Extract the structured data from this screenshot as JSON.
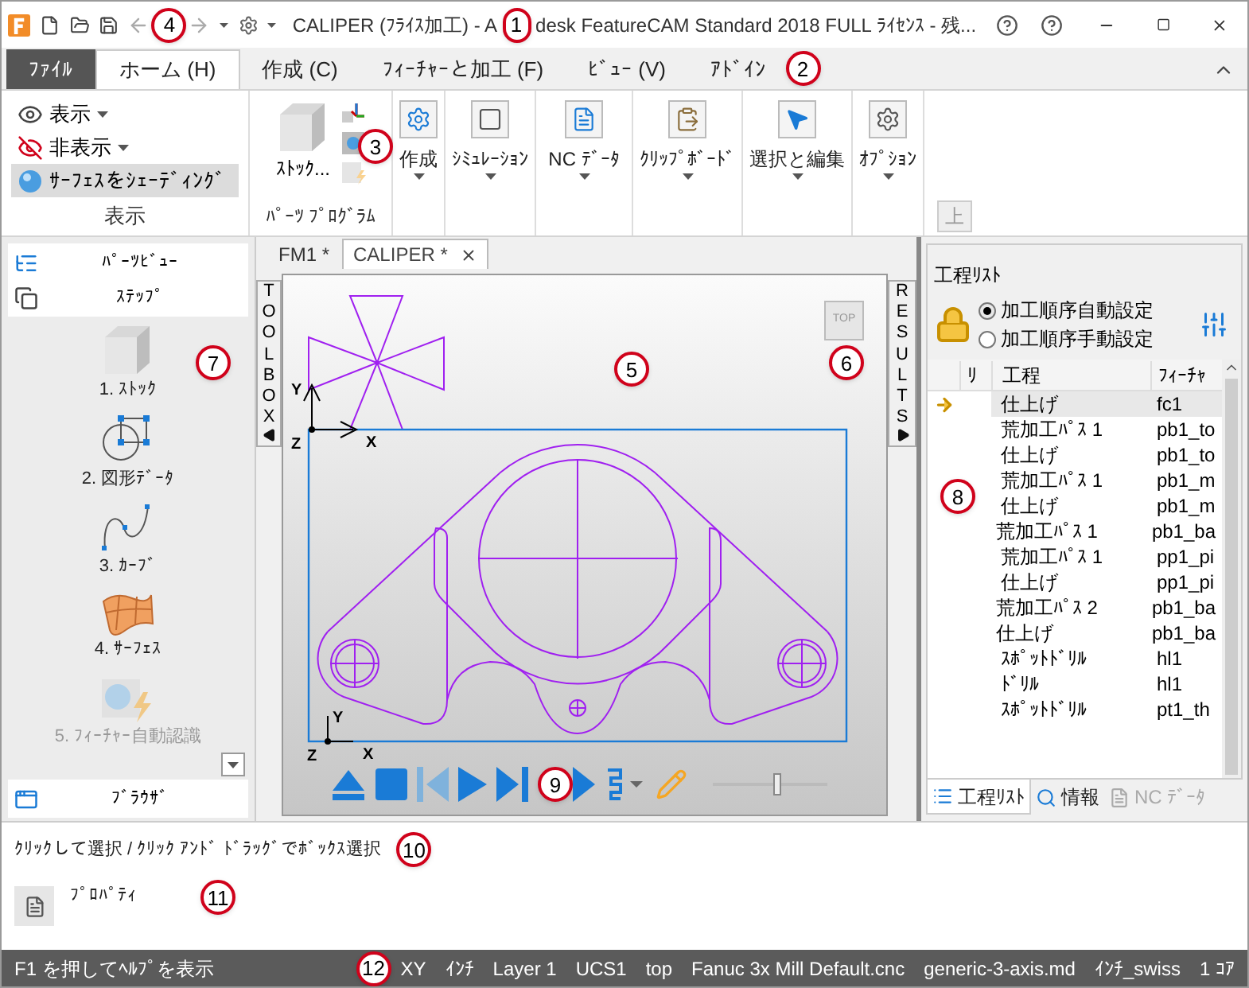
{
  "title_bar": {
    "undo_callout": "4",
    "title_parts": [
      "CALIPER (ﾌﾗｲｽ加工) - A",
      "desk FeatureCAM Standard 2018 FULL ﾗｲｾﾝｽ - 残..."
    ],
    "title_callout": "1"
  },
  "file_tab": "ﾌｧｲﾙ",
  "ribbon_tabs": [
    {
      "label": "ホーム (H)",
      "selected": true
    },
    {
      "label": "作成 (C)",
      "selected": false
    },
    {
      "label": "ﾌｨｰﾁｬｰと加工 (F)",
      "selected": false
    },
    {
      "label": "ﾋﾞｭｰ (V)",
      "selected": false
    },
    {
      "label": "ｱﾄﾞｲﾝ",
      "selected": false
    }
  ],
  "tabs_callout": "2",
  "ribbon": {
    "display_group": {
      "label": "表示",
      "items": [
        {
          "label": "表示",
          "kind": "show",
          "on": false
        },
        {
          "label": "非表示",
          "kind": "hide",
          "on": false
        },
        {
          "label": "ｻｰﾌｪｽをｼｪｰﾃﾞｨﾝｸﾞ",
          "kind": "shade",
          "on": true
        }
      ]
    },
    "parts_group": {
      "stock": "ｽﾄｯｸ...",
      "callout": "3",
      "label": "ﾊﾟｰﾂ ﾌﾟﾛｸﾞﾗﾑ"
    },
    "buttons": [
      {
        "label": "作成",
        "kind": "create"
      },
      {
        "label": "ｼﾐｭﾚｰｼｮﾝ",
        "kind": "simulation"
      },
      {
        "label": "NC ﾃﾞｰﾀ",
        "kind": "nc"
      },
      {
        "label": "ｸﾘｯﾌﾟﾎﾞｰﾄﾞ",
        "kind": "clipboard"
      },
      {
        "label": "選択と編集",
        "kind": "select"
      },
      {
        "label": "ｵﾌﾟｼｮﾝ",
        "kind": "options"
      }
    ],
    "up_button": "上"
  },
  "left_panel": {
    "nav": [
      {
        "label": "ﾊﾟｰﾂﾋﾞｭｰ",
        "kind": "tree"
      },
      {
        "label": "ｽﾃｯﾌﾟ",
        "kind": "steps"
      }
    ],
    "callout": "7",
    "steps": [
      {
        "label": "1. ｽﾄｯｸ",
        "kind": "stock",
        "disabled": false
      },
      {
        "label": "2. 図形ﾃﾞｰﾀ",
        "kind": "geometry",
        "disabled": false
      },
      {
        "label": "3. ｶｰﾌﾞ",
        "kind": "curve",
        "disabled": false
      },
      {
        "label": "4. ｻｰﾌｪｽ",
        "kind": "surface",
        "disabled": false
      },
      {
        "label": "5. ﾌｨｰﾁｬｰ自動認識",
        "kind": "recognition",
        "disabled": true
      }
    ],
    "browser_tab": "ﾌﾞﾗｳｻﾞ"
  },
  "doc_tabs": [
    {
      "label": "FM1 *",
      "selected": false
    },
    {
      "label": "CALIPER *",
      "selected": true
    }
  ],
  "viewport": {
    "toolbox_label": "TOOLBOX",
    "results_label": "RESULTS",
    "view_cube": "TOP",
    "callout": "5",
    "view_cube_callout": "6",
    "axes": [
      {
        "y": "Y",
        "x": "X",
        "z": "Z"
      },
      {
        "y": "Y",
        "x": "X",
        "z": "Z"
      }
    ],
    "toolbar_callout": "9",
    "speed_slider": {
      "level": 0.55
    }
  },
  "process_panel": {
    "title": "工程ﾘｽﾄ",
    "order_modes": [
      {
        "label": "加工順序自動設定",
        "selected": true
      },
      {
        "label": "加工順序手動設定",
        "selected": false
      }
    ],
    "columns": [
      "ﾘ",
      "工程",
      "ﾌｨｰﾁｬ"
    ],
    "callout": "8",
    "rows": [
      {
        "process": "仕上げ",
        "feature": "fc1",
        "selected": true
      },
      {
        "process": "荒加工ﾊﾟｽ 1",
        "feature": "pb1_to",
        "selected": false
      },
      {
        "process": "仕上げ",
        "feature": "pb1_to",
        "selected": false
      },
      {
        "process": "荒加工ﾊﾟｽ 1",
        "feature": "pb1_m",
        "selected": false
      },
      {
        "process": "仕上げ",
        "feature": "pb1_m",
        "selected": false
      },
      {
        "process": "荒加工ﾊﾟｽ 1",
        "feature": "pb1_ba",
        "selected": false
      },
      {
        "process": "荒加工ﾊﾟｽ 1",
        "feature": "pp1_pi",
        "selected": false
      },
      {
        "process": "仕上げ",
        "feature": "pp1_pi",
        "selected": false
      },
      {
        "process": "荒加工ﾊﾟｽ 2",
        "feature": "pb1_ba",
        "selected": false
      },
      {
        "process": "仕上げ",
        "feature": "pb1_ba",
        "selected": false
      },
      {
        "process": "ｽﾎﾟｯﾄﾄﾞﾘﾙ",
        "feature": "hl1",
        "selected": false
      },
      {
        "process": "ﾄﾞﾘﾙ",
        "feature": "hl1",
        "selected": false
      },
      {
        "process": "ｽﾎﾟｯﾄﾄﾞﾘﾙ",
        "feature": "pt1_th",
        "selected": false
      }
    ],
    "tabs": [
      {
        "label": "工程ﾘｽﾄ",
        "kind": "list",
        "selected": true,
        "disabled": false
      },
      {
        "label": "情報",
        "kind": "info",
        "selected": false,
        "disabled": false
      },
      {
        "label": "NC ﾃﾞｰﾀ",
        "kind": "nc",
        "selected": false,
        "disabled": true
      }
    ]
  },
  "prompt": "ｸﾘｯｸして選択 / ｸﾘｯｸ ｱﾝﾄﾞ ﾄﾞﾗｯｸﾞでﾎﾞｯｸｽ選択",
  "prompt_callout": "10",
  "properties_label": "ﾌﾟﾛﾊﾟﾃｨ",
  "properties_callout": "11",
  "status_bar": {
    "help": "F1 を押してﾍﾙﾌﾟを表示",
    "callout": "12",
    "items": [
      "XY",
      "ｲﾝﾁ",
      "Layer 1",
      "UCS1",
      "top",
      "Fanuc 3x Mill Default.cnc",
      "generic-3-axis.md",
      "ｲﾝﾁ_swiss",
      "1 ｺｱ"
    ]
  }
}
